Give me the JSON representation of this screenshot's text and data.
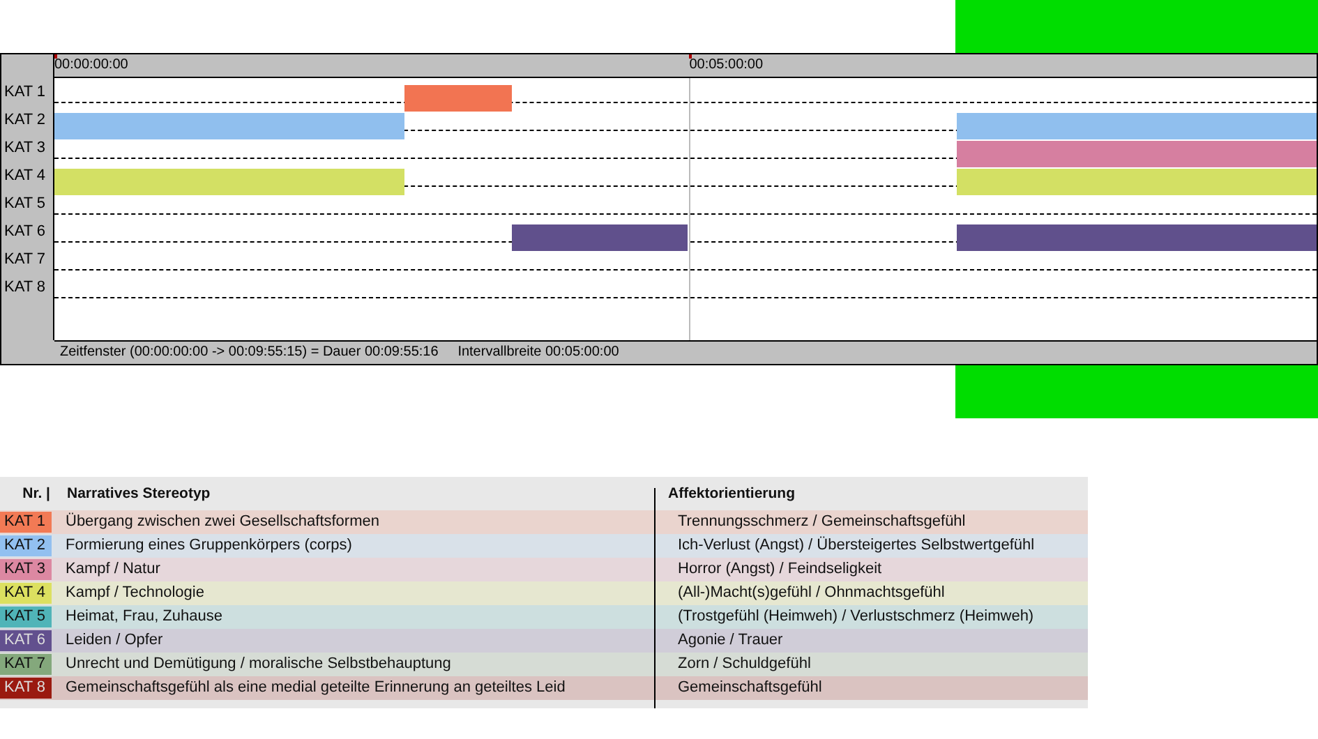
{
  "timeline": {
    "ruler_labels": [
      "00:00:00:00",
      "00:05:00:00"
    ],
    "rows": [
      {
        "label": "KAT 1",
        "color": "#f27452"
      },
      {
        "label": "KAT 2",
        "color": "#90bfee"
      },
      {
        "label": "KAT 3",
        "color": "#d67fa0"
      },
      {
        "label": "KAT 4",
        "color": "#d3e064"
      },
      {
        "label": "KAT 5"
      },
      {
        "label": "KAT 6",
        "color": "#60508c"
      },
      {
        "label": "KAT 7"
      },
      {
        "label": "KAT 8"
      }
    ],
    "status": "Zeitfenster (00:00:00:00 -> 00:09:55:15) = Dauer 00:09:55:16     Intervallbreite 00:05:00:00"
  },
  "legend": {
    "columns": [
      "Nr. |",
      "Narratives Stereotyp",
      "Affektorientierung"
    ],
    "rows": [
      {
        "nr": "KAT 1",
        "color": "#f27a55",
        "stereotype": "Übergang zwischen zwei Gesellschaftsformen",
        "affect": "Trennungsschmerz / Gemeinschaftsgefühl"
      },
      {
        "nr": "KAT 2",
        "color": "#92c0f0",
        "stereotype": "Formierung eines Gruppenkörpers (corps)",
        "affect": "Ich-Verlust (Angst) / Übersteigertes Selbstwertgefühl"
      },
      {
        "nr": "KAT 3",
        "color": "#dc88a2",
        "stereotype": "Kampf / Natur",
        "affect": "Horror (Angst) / Feindseligkeit"
      },
      {
        "nr": "KAT 4",
        "color": "#dce060",
        "stereotype": "Kampf / Technologie",
        "affect": "(All-)Macht(s)gefühl / Ohnmachtsgefühl"
      },
      {
        "nr": "KAT 5",
        "color": "#50b4b8",
        "stereotype": "Heimat, Frau, Zuhause",
        "affect": "(Trostgefühl (Heimweh) / Verlustschmerz (Heimweh)"
      },
      {
        "nr": "KAT 6",
        "color": "#62508e",
        "stereotype": "Leiden / Opfer",
        "affect": "Agonie / Trauer"
      },
      {
        "nr": "KAT 7",
        "color": "#84a87c",
        "stereotype": "Unrecht und Demütigung / moralische Selbstbehauptung",
        "affect": "Zorn / Schuldgefühl"
      },
      {
        "nr": "KAT 8",
        "color": "#9a1a10",
        "stereotype": "Gemeinschaftsgefühl als eine medial geteilte Erinnerung an geteiltes Leid",
        "affect": "Gemeinschaftsgefühl"
      }
    ]
  }
}
